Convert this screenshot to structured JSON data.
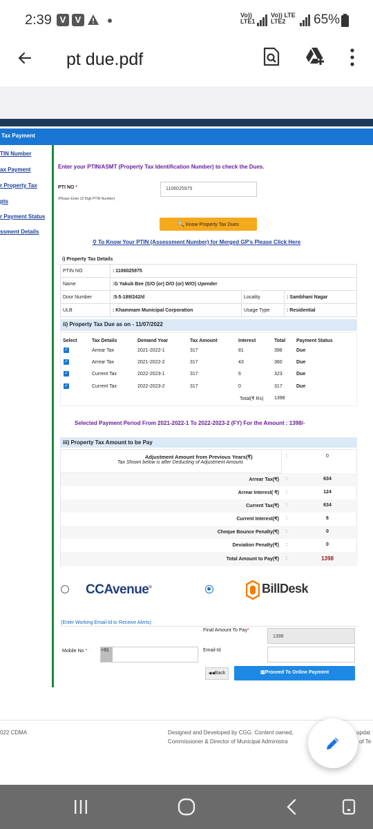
{
  "status_bar": {
    "time": "2:39",
    "badge_1": "V",
    "badge_2": "V",
    "net1": "Vo))",
    "net1_sub": "LTE1",
    "net2": "Vo)) LTE",
    "net2_sub": "LTE2",
    "battery": "65%"
  },
  "app_bar": {
    "title": "pt due.pdf"
  },
  "sidebar": {
    "header": "Tax Payment",
    "items": [
      "TIN Number",
      "ax Payment",
      "r Property Tax",
      "pts",
      "r Payment Status",
      "ssment Details"
    ]
  },
  "form": {
    "instruction": "Enter your PTIN/ASMT (Property Tax Identification Number) to check the Dues.",
    "ptin_label": "PTI NO",
    "required_mark": "*",
    "ptin_hint": "(Please Enter 10 Digit PTIN Number)",
    "ptin_value": "1106025975",
    "know_button": "Know Property Tax Dues",
    "merged_link": "To Know Your PTIN (Assessment Number) for Merged GP's Please Click Here"
  },
  "details": {
    "section_title": "i) Property Tax Details",
    "ptin_no_label": "PTIN NO",
    "ptin_no_value": ": 1106025975",
    "name_label": "Name",
    "name_value": ":G Yakub Bee (S/O (or) D/O (or) W/O) Upender",
    "door_label": "Door Number",
    "door_value": ":5-5-189/242/d",
    "locality_label": "Locality",
    "locality_value": ": Sambhani Nagar",
    "ulb_label": "ULB",
    "ulb_value": ": Khammam Municipal Corporation",
    "usage_label": "Usage Type",
    "usage_value": ": Residential"
  },
  "dues": {
    "section_title": "ii) Property Tax Due as on - 11/07/2022",
    "headers": [
      "Select",
      "Tax Details",
      "Demand Year",
      "Tax Amount",
      "Interest",
      "Total",
      "Payment Status"
    ],
    "rows": [
      {
        "tax": "Arrear Tax",
        "year": "2021-2022-1",
        "amount": "317",
        "interest": "81",
        "total": "398",
        "status": "Due"
      },
      {
        "tax": "Arrear Tax",
        "year": "2021-2022-2",
        "amount": "317",
        "interest": "43",
        "total": "360",
        "status": "Due"
      },
      {
        "tax": "Current Tax",
        "year": "2022-2023-1",
        "amount": "317",
        "interest": "6",
        "total": "323",
        "status": "Due"
      },
      {
        "tax": "Current Tax",
        "year": "2022-2023-2",
        "amount": "317",
        "interest": "0",
        "total": "317",
        "status": "Due"
      }
    ],
    "total_label": "Total(₹ Rs)",
    "total_value": "1398"
  },
  "selected_period": "Selected Payment Period From 2021-2022-1 To 2022-2023-2 (FY) For the Amount : 1398/-",
  "amount": {
    "section_title": "iii) Property Tax Amount to be Pay",
    "adjustment_label": "Adjustment Amount from Previous Years(₹)",
    "adjustment_note": "Tax Shown below is after Deducting of Adjustment Amount.",
    "adjustment_value": "0",
    "colon": ":",
    "rows": [
      {
        "label": "Arrear Tax(₹)",
        "value": "634"
      },
      {
        "label": "Arrear Interest( ₹)",
        "value": "124"
      },
      {
        "label": "Current Tax(₹)",
        "value": "634"
      },
      {
        "label": "Current Interest(₹)",
        "value": "6"
      },
      {
        "label": "Cheque Bounce Penalty(₹)",
        "value": "0"
      },
      {
        "label": "Deviation Penalty(₹)",
        "value": "0"
      }
    ],
    "total_label": "Total Amount to Pay(₹)",
    "total_value": "1398"
  },
  "payment": {
    "ccavenue": "CCAvenue",
    "billdesk": "BillDesk",
    "email_note": "(Enter Working Email-Id to Receive Alerts)",
    "final_label": "Final Amount To Pay",
    "final_value": "1398",
    "mobile_label": "Mobile No",
    "mobile_prefix": "+91",
    "email_label": "Email-Id",
    "back_button": "Back",
    "proceed_button": "Proceed To Online Payment"
  },
  "footer": {
    "copyright": "022 CDMA",
    "credit_1": "Designed and Developed by CGG. Content owned,",
    "credit_2": "Commissioner & Director of Municipal Administra",
    "right_1": "updat",
    "right_2": "of Te"
  },
  "colors": {
    "navy": "#1e3a5a",
    "blue": "#1976d2",
    "green": "#1b8a3a",
    "purple": "#6a1b9a",
    "yellow": "#f5a91c",
    "red": "#d32f2f"
  }
}
